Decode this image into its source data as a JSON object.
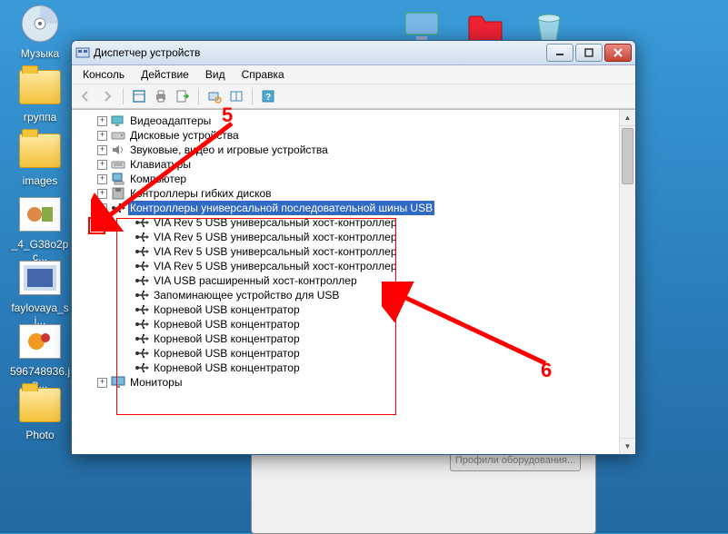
{
  "desktop_icons": {
    "music": "Музыка",
    "group": "группа",
    "images": "images",
    "file1": "_4_G38o2pc...",
    "file2": "faylovaya_si...",
    "file3": "596748936.jp...",
    "photo": "Photo"
  },
  "window": {
    "title": "Диспетчер устройств",
    "menu": {
      "console": "Консоль",
      "action": "Действие",
      "view": "Вид",
      "help": "Справка"
    }
  },
  "tree": {
    "video": "Видеоадаптеры",
    "disk": "Дисковые устройства",
    "sound": "Звуковые, видео и игровые устройства",
    "keyboard": "Клавиатуры",
    "computer": "Компьютер",
    "floppy": "Контроллеры гибких дисков",
    "usb": "Контроллеры универсальной последовательной шины USB",
    "usb_children": {
      "c0": "VIA Rev 5 USB универсальный хост-контроллер",
      "c1": "VIA Rev 5 USB универсальный хост-контроллер",
      "c2": "VIA Rev 5 USB универсальный хост-контроллер",
      "c3": "VIA Rev 5 USB универсальный хост-контроллер",
      "c4": "VIA USB расширенный хост-контроллер",
      "c5": "Запоминающее устройство для USB",
      "c6": "Корневой USB концентратор",
      "c7": "Корневой USB концентратор",
      "c8": "Корневой USB концентратор",
      "c9": "Корневой USB концентратор",
      "c10": "Корневой USB концентратор"
    },
    "monitors": "Мониторы"
  },
  "annotations": {
    "label5": "5",
    "label6": "6"
  },
  "toggle": {
    "plus": "+",
    "minus": "−"
  },
  "fragment_button": "Профили оборудования..."
}
